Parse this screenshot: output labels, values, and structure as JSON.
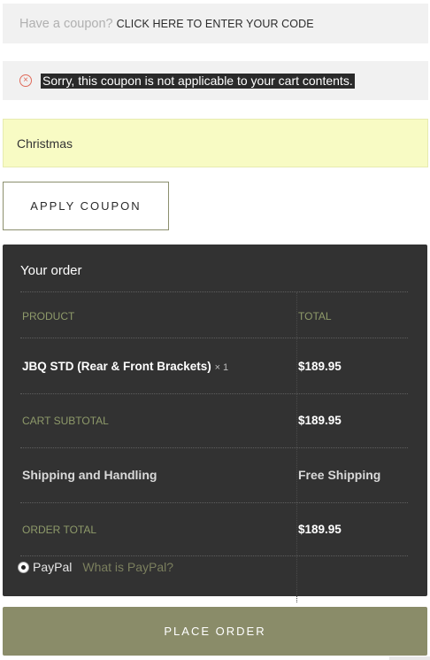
{
  "coupon_notice": {
    "prompt": "Have a coupon?",
    "link": "CLICK HERE TO ENTER YOUR CODE"
  },
  "error": {
    "icon": "error-circle-icon",
    "message": "Sorry, this coupon is not applicable to your cart contents."
  },
  "coupon_field": {
    "value": "Christmas"
  },
  "apply_button": {
    "label": "APPLY COUPON"
  },
  "order": {
    "title": "Your order",
    "headers": {
      "product": "PRODUCT",
      "total": "TOTAL"
    },
    "item": {
      "name": "JBQ STD (Rear & Front Brackets)",
      "qty": "× 1",
      "total": "$189.95"
    },
    "subtotal": {
      "label": "CART SUBTOTAL",
      "value": "$189.95"
    },
    "shipping": {
      "label": "Shipping and Handling",
      "value": "Free Shipping"
    },
    "order_total": {
      "label": "ORDER TOTAL",
      "value": "$189.95"
    }
  },
  "payment": {
    "method": "PayPal",
    "info_link": "What is PayPal?",
    "selected": true
  },
  "place_order": {
    "label": "PLACE ORDER"
  },
  "colors": {
    "accent": "#8a8c69",
    "panel": "#323232",
    "error": "#e06a5a",
    "coupon_input_bg": "#f8fbc4"
  }
}
